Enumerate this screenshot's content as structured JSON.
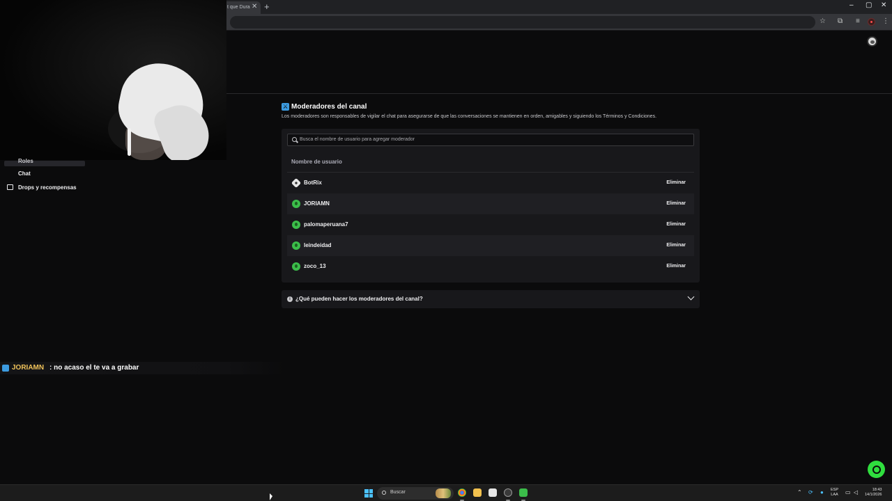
{
  "browser": {
    "tab_title": "t que Dura",
    "tab_close": "✕",
    "new_tab": "+",
    "window_controls": [
      "–",
      "▢",
      "✕"
    ],
    "toolbar_icons": [
      "star-icon",
      "extensions-icon",
      "tab-search-icon",
      "extension-red-icon",
      "menu-icon"
    ]
  },
  "sidebar": {
    "items": [
      {
        "label": "Roles",
        "icon": ""
      },
      {
        "label": "Chat",
        "icon": ""
      },
      {
        "label": "Drops y recompensas",
        "icon": "gift-icon"
      }
    ]
  },
  "main": {
    "title": "Moderadores del canal",
    "description": "Los moderadores son responsables de vigilar el chat para asegurarse de que las conversaciones se mantienen en orden, amigables y siguiendo los Términos y Condiciones.",
    "search_placeholder": "Busca el nombre de usuario para agregar moderador",
    "column_header": "Nombre de usuario",
    "remove_label": "Eliminar",
    "moderators": [
      {
        "name": "BotRix",
        "icon": "bot-icon"
      },
      {
        "name": "JORIAMN",
        "icon": "user-avatar-icon"
      },
      {
        "name": "palomaperuana7",
        "icon": "user-avatar-icon"
      },
      {
        "name": "leindeidad",
        "icon": "user-avatar-icon"
      },
      {
        "name": "zoco_13",
        "icon": "user-avatar-icon"
      }
    ],
    "faq_question": "¿Qué pueden hacer los moderadores del canal?",
    "accent_color": "#53fc18"
  },
  "chat_overlay": {
    "username": "JORIAMN",
    "message": ": no acaso el te va a grabar",
    "username_color": "#f1c35a"
  },
  "taskbar": {
    "search_label": "Buscar",
    "language": "ESP",
    "layout": "LAA",
    "time": "18:43",
    "date": "14/1/2026"
  }
}
